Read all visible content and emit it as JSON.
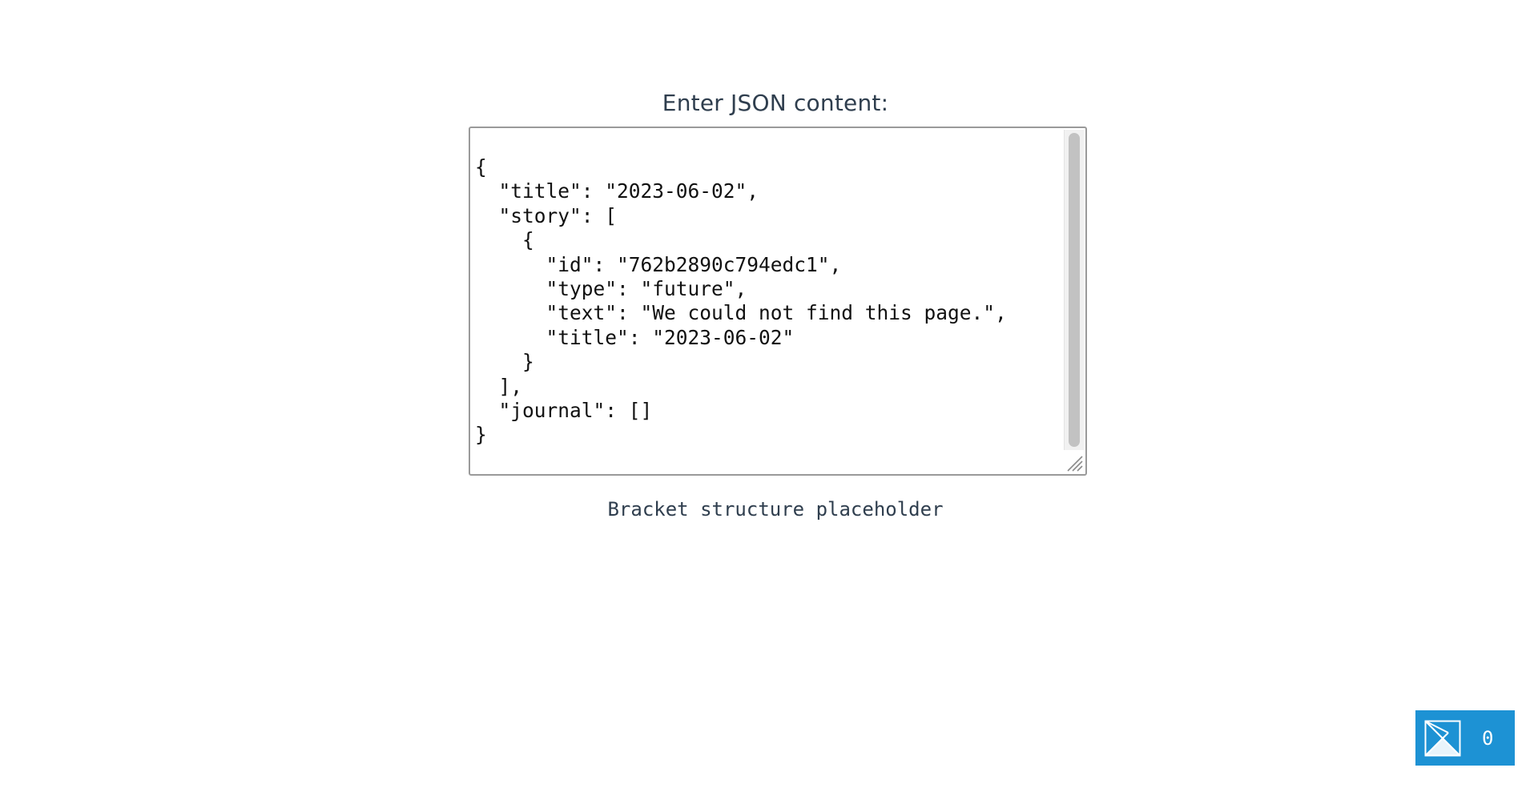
{
  "form": {
    "prompt_label": "Enter JSON content:",
    "json_text": "{\n  \"title\": \"2023-06-02\",\n  \"story\": [\n    {\n      \"id\": \"762b2890c794edc1\",\n      \"type\": \"future\",\n      \"text\": \"We could not find this page.\",\n      \"title\": \"2023-06-02\"\n    }\n  ],\n  \"journal\": []\n}",
    "bracket_info": "Bracket structure placeholder"
  },
  "badge": {
    "icon": "envelope-logo-icon",
    "count": "0",
    "background_color": "#1d92d4"
  }
}
